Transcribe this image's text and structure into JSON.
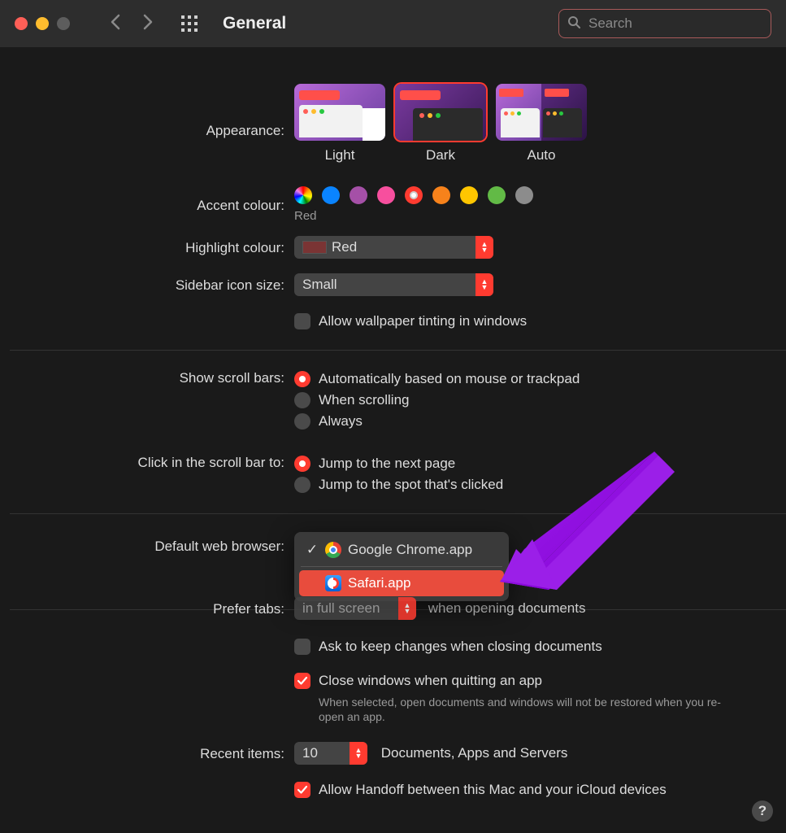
{
  "window": {
    "title": "General"
  },
  "search": {
    "placeholder": "Search"
  },
  "appearance": {
    "label": "Appearance:",
    "options": {
      "light": "Light",
      "dark": "Dark",
      "auto": "Auto"
    },
    "selected": "dark"
  },
  "accent": {
    "label": "Accent colour:",
    "selected_name": "Red",
    "colors": [
      {
        "name": "multicolor",
        "value": "multicolor"
      },
      {
        "name": "blue",
        "value": "#0a84ff"
      },
      {
        "name": "purple",
        "value": "#a550a7"
      },
      {
        "name": "pink",
        "value": "#f74f9e"
      },
      {
        "name": "red",
        "value": "#ff3b30"
      },
      {
        "name": "orange",
        "value": "#f7821b"
      },
      {
        "name": "yellow",
        "value": "#ffc600"
      },
      {
        "name": "green",
        "value": "#62ba46"
      },
      {
        "name": "graphite",
        "value": "#8c8c8c"
      }
    ]
  },
  "highlight": {
    "label": "Highlight colour:",
    "value": "Red"
  },
  "sidebar_icon": {
    "label": "Sidebar icon size:",
    "value": "Small"
  },
  "wallpaper_tint": {
    "label": "Allow wallpaper tinting in windows",
    "checked": false
  },
  "scrollbars": {
    "label": "Show scroll bars:",
    "options": [
      {
        "label": "Automatically based on mouse or trackpad",
        "checked": true
      },
      {
        "label": "When scrolling",
        "checked": false
      },
      {
        "label": "Always",
        "checked": false
      }
    ]
  },
  "scroll_click": {
    "label": "Click in the scroll bar to:",
    "options": [
      {
        "label": "Jump to the next page",
        "checked": true
      },
      {
        "label": "Jump to the spot that's clicked",
        "checked": false
      }
    ]
  },
  "default_browser": {
    "label": "Default web browser:",
    "menu": [
      {
        "label": "Google Chrome.app",
        "checked": true,
        "highlight": false,
        "icon": "chrome"
      },
      {
        "label": "Safari.app",
        "checked": false,
        "highlight": true,
        "icon": "safari"
      }
    ]
  },
  "prefer_tabs": {
    "label": "Prefer tabs:",
    "select_value": "in full screen",
    "suffix": "when opening documents"
  },
  "ask_keep": {
    "label": "Ask to keep changes when closing documents",
    "checked": false
  },
  "close_windows": {
    "label": "Close windows when quitting an app",
    "help": "When selected, open documents and windows will not be restored when you re-open an app.",
    "checked": true
  },
  "recent": {
    "label": "Recent items:",
    "value": "10",
    "suffix": "Documents, Apps and Servers"
  },
  "handoff": {
    "label": "Allow Handoff between this Mac and your iCloud devices",
    "checked": true
  },
  "help_button": "?"
}
